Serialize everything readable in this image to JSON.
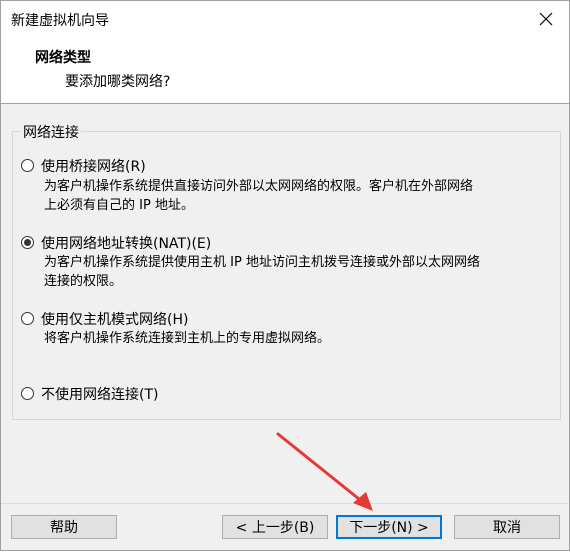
{
  "window": {
    "title": "新建虚拟机向导"
  },
  "header": {
    "title": "网络类型",
    "subtitle": "要添加哪类网络?"
  },
  "group": {
    "legend": "网络连接"
  },
  "options": [
    {
      "label": "使用桥接网络(R)",
      "checked": false,
      "desc_lines": [
        "为客户机操作系统提供直接访问外部以太网网络的权限。客户机在外部网络",
        "上必须有自己的 IP 地址。"
      ]
    },
    {
      "label": "使用网络地址转换(NAT)(E)",
      "checked": true,
      "desc_lines": [
        "为客户机操作系统提供使用主机 IP 地址访问主机拨号连接或外部以太网网络",
        "连接的权限。"
      ]
    },
    {
      "label": "使用仅主机模式网络(H)",
      "checked": false,
      "desc_lines": [
        "将客户机操作系统连接到主机上的专用虚拟网络。"
      ]
    },
    {
      "label": "不使用网络连接(T)",
      "checked": false,
      "desc_lines": []
    }
  ],
  "buttons": {
    "help": "帮助",
    "back": "< 上一步(B)",
    "next": "下一步(N) >",
    "cancel": "取消"
  },
  "colors": {
    "window_bg": "#f0f0f0",
    "focus_border": "#0078d7",
    "annotation_arrow": "#e53935"
  }
}
